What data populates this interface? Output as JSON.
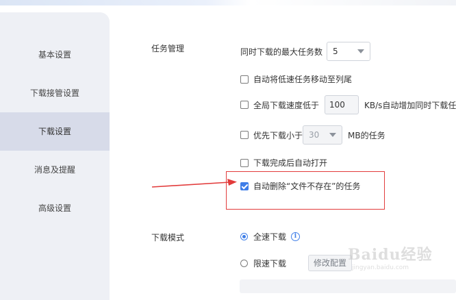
{
  "sidebar": {
    "items": [
      {
        "label": "基本设置"
      },
      {
        "label": "下载接管设置"
      },
      {
        "label": "下载设置"
      },
      {
        "label": "消息及提醒"
      },
      {
        "label": "高级设置"
      }
    ],
    "active_index": 2
  },
  "task_management": {
    "title": "任务管理",
    "max_tasks_label": "同时下载的最大任务数",
    "max_tasks_value": "5",
    "move_slow_label": "自动将低速任务移动至列尾",
    "move_slow_checked": false,
    "global_speed_label_pre": "全局下载速度低于",
    "global_speed_value": "100",
    "global_speed_label_post": "KB/s自动增加同时下载任",
    "global_speed_checked": false,
    "small_first_label_pre": "优先下载小于",
    "small_first_value": "30",
    "small_first_label_post": "MB的任务",
    "small_first_checked": false,
    "auto_open_label": "下载完成后自动打开",
    "auto_open_checked": false,
    "auto_delete_label": "自动删除“文件不存在”的任务",
    "auto_delete_checked": true
  },
  "download_mode": {
    "title": "下载模式",
    "full_speed_label": "全速下载",
    "limited_label": "限速下载",
    "selected": "full_speed",
    "modify_button": "修改配置"
  },
  "watermark": {
    "main": "Baidu经验",
    "sub": "jingyan.baidu.com"
  },
  "colors": {
    "accent": "#3f7ee8",
    "annotation": "#e23b3b",
    "sidebar_bg": "#eef0f5",
    "sidebar_active": "#d7dbe9"
  }
}
